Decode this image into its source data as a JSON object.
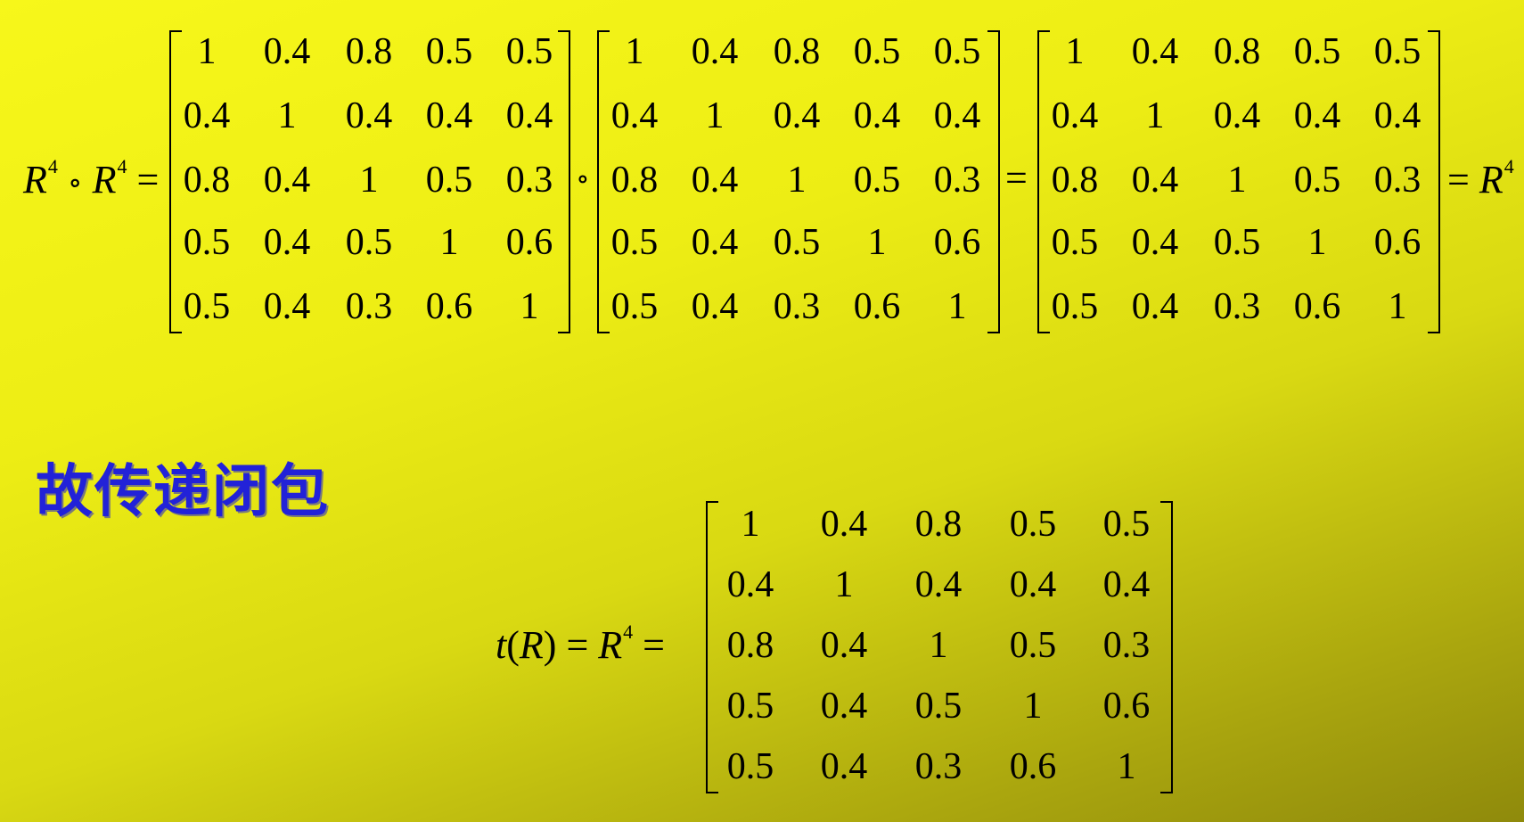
{
  "equation_top": {
    "lhs_R": "R",
    "lhs_exp_1": "4",
    "compose_op": "∘",
    "lhs_R2": "R",
    "lhs_exp_2": "4",
    "equals_1": "=",
    "compose_op_between": "∘",
    "equals_2": "=",
    "equals_3": "=",
    "rhs_R": "R",
    "rhs_exp": "4",
    "matrix_1": [
      [
        "1",
        "0.4",
        "0.8",
        "0.5",
        "0.5"
      ],
      [
        "0.4",
        "1",
        "0.4",
        "0.4",
        "0.4"
      ],
      [
        "0.8",
        "0.4",
        "1",
        "0.5",
        "0.3"
      ],
      [
        "0.5",
        "0.4",
        "0.5",
        "1",
        "0.6"
      ],
      [
        "0.5",
        "0.4",
        "0.3",
        "0.6",
        "1"
      ]
    ],
    "matrix_2": [
      [
        "1",
        "0.4",
        "0.8",
        "0.5",
        "0.5"
      ],
      [
        "0.4",
        "1",
        "0.4",
        "0.4",
        "0.4"
      ],
      [
        "0.8",
        "0.4",
        "1",
        "0.5",
        "0.3"
      ],
      [
        "0.5",
        "0.4",
        "0.5",
        "1",
        "0.6"
      ],
      [
        "0.5",
        "0.4",
        "0.3",
        "0.6",
        "1"
      ]
    ],
    "matrix_3": [
      [
        "1",
        "0.4",
        "0.8",
        "0.5",
        "0.5"
      ],
      [
        "0.4",
        "1",
        "0.4",
        "0.4",
        "0.4"
      ],
      [
        "0.8",
        "0.4",
        "1",
        "0.5",
        "0.3"
      ],
      [
        "0.5",
        "0.4",
        "0.5",
        "1",
        "0.6"
      ],
      [
        "0.5",
        "0.4",
        "0.3",
        "0.6",
        "1"
      ]
    ]
  },
  "heading": "故传递闭包",
  "equation_bottom": {
    "t": "t",
    "open_paren": "(",
    "R": "R",
    "close_paren": ")",
    "equals_1": "=",
    "R2": "R",
    "exp": "4",
    "equals_2": "=",
    "matrix": [
      [
        "1",
        "0.4",
        "0.8",
        "0.5",
        "0.5"
      ],
      [
        "0.4",
        "1",
        "0.4",
        "0.4",
        "0.4"
      ],
      [
        "0.8",
        "0.4",
        "1",
        "0.5",
        "0.3"
      ],
      [
        "0.5",
        "0.4",
        "0.5",
        "1",
        "0.6"
      ],
      [
        "0.5",
        "0.4",
        "0.3",
        "0.6",
        "1"
      ]
    ]
  },
  "colors": {
    "heading": "#2222d8",
    "background_start": "#f7f71a",
    "background_end": "#8f8a0c"
  }
}
